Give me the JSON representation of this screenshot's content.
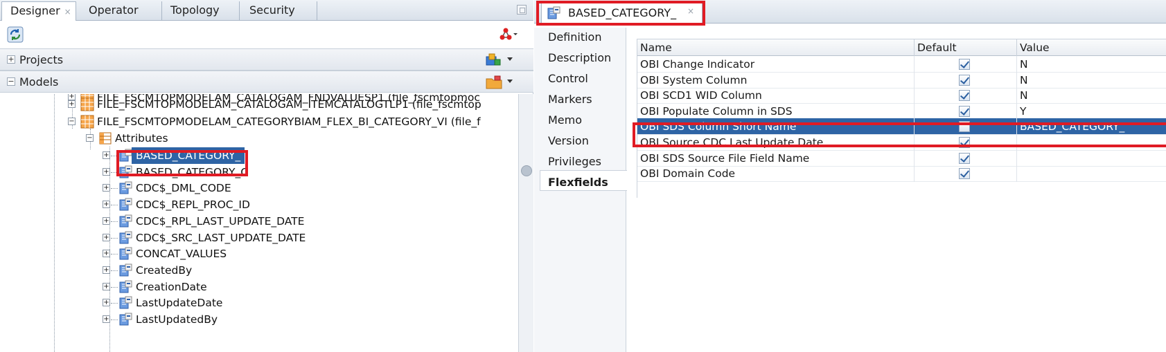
{
  "left_panel": {
    "tabs": [
      {
        "label": "Designer",
        "close": "×"
      },
      {
        "label": "Operator"
      },
      {
        "label": "Topology"
      },
      {
        "label": "Security"
      }
    ],
    "sections": {
      "projects": {
        "toggle": "+",
        "label": "Projects"
      },
      "models": {
        "toggle": "−",
        "label": "Models"
      }
    },
    "tree": {
      "datastores": [
        "FILE_FSCMTOPMODELAM_CATALOGAM_FNDVALUESP1 (file_fscmtopmoc",
        "FILE_FSCMTOPMODELAM_CATALOGAM_ITEMCATALOGTLP1 (file_fscmtop",
        "FILE_FSCMTOPMODELAM_CATEGORYBIAM_FLEX_BI_CATEGORY_VI (file_f"
      ],
      "attributes_label": "Attributes",
      "attributes": [
        "BASED_CATEGORY_",
        "BASED_CATEGORY_C",
        "CDC$_DML_CODE",
        "CDC$_REPL_PROC_ID",
        "CDC$_RPL_LAST_UPDATE_DATE",
        "CDC$_SRC_LAST_UPDATE_DATE",
        "CONCAT_VALUES",
        "CreatedBy",
        "CreationDate",
        "LastUpdateDate",
        "LastUpdatedBy"
      ],
      "selected_attribute": "BASED_CATEGORY_"
    }
  },
  "right_panel": {
    "editor_tab": {
      "title": "BASED_CATEGORY_",
      "close": "×"
    },
    "nav_items": [
      "Definition",
      "Description",
      "Control",
      "Markers",
      "Memo",
      "Version",
      "Privileges",
      "Flexfields"
    ],
    "active_nav": "Flexfields",
    "table": {
      "columns": [
        "Name",
        "Default",
        "Value"
      ],
      "rows": [
        {
          "name": "OBI Change Indicator",
          "default": true,
          "value": "N"
        },
        {
          "name": "OBI System Column",
          "default": true,
          "value": "N"
        },
        {
          "name": "OBI SCD1 WID Column",
          "default": true,
          "value": "N"
        },
        {
          "name": "OBI Populate Column in SDS",
          "default": true,
          "value": "Y"
        },
        {
          "name": "OBI SDS Column Short Name",
          "default": false,
          "value": "BASED_CATEGORY_"
        },
        {
          "name": "OBI Source CDC Last Update Date",
          "default": true,
          "value": ""
        },
        {
          "name": "OBI SDS Source File Field Name",
          "default": true,
          "value": ""
        },
        {
          "name": "OBI Domain Code",
          "default": true,
          "value": ""
        }
      ],
      "selected_row": "OBI SDS Column Short Name"
    }
  },
  "colors": {
    "selection": "#2e64a5",
    "highlight_box": "#e01b24"
  },
  "icons": [
    "refresh-icon",
    "connect-icon",
    "project-add-icon",
    "model-folder-icon",
    "datastore-icon",
    "attributes-folder-icon",
    "column-icon"
  ]
}
